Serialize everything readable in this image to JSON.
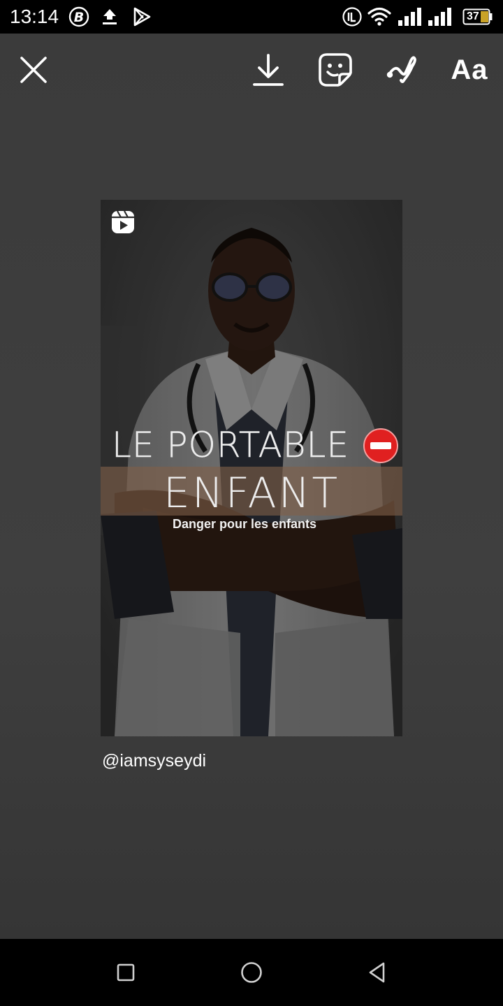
{
  "status_bar": {
    "time": "13:14",
    "battery_level": "37",
    "icons": [
      "b-circle-icon",
      "upload-arrow-icon",
      "play-store-icon",
      "volte-icon",
      "wifi-icon",
      "signal-icon",
      "signal-icon",
      "battery-icon"
    ]
  },
  "toolbar": {
    "close_icon": "close-icon",
    "download_icon": "download-icon",
    "sticker_icon": "sticker-icon",
    "draw_icon": "draw-icon",
    "text_tool_label": "Aa"
  },
  "post": {
    "reel_icon": "reels-icon",
    "headline_line1": "LE PORTABLE",
    "headline_line2": "ENFANT",
    "subheadline": "Danger pour les enfants",
    "emoji_icon": "no-entry-icon"
  },
  "mention": "@iamsyseydi",
  "nav_bar": {
    "icons": [
      "recents-square-icon",
      "home-circle-icon",
      "back-triangle-icon"
    ]
  },
  "colors": {
    "editor_background": "#3d3d3d",
    "system_bar": "#000000",
    "banner_band": "#805f48",
    "no_entry_red": "#e02020"
  }
}
